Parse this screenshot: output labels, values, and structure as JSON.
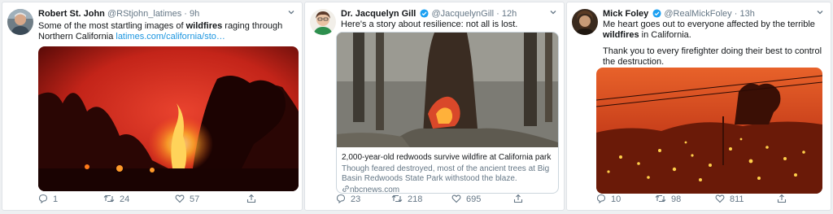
{
  "tweets": [
    {
      "name": "Robert St. John",
      "handle": "@RStjohn_latimes",
      "time": "9h",
      "text_before": "Some of the most startling images of ",
      "keyword": "wildfires",
      "text_after": " raging through Northern California ",
      "link": "latimes.com/california/sto…",
      "replies": "1",
      "retweets": "24",
      "likes": "57",
      "verified": false
    },
    {
      "name": "Dr. Jacquelyn Gill",
      "handle": "@JacquelynGill",
      "time": "12h",
      "text": "Here's a story about resilience: not all is lost.",
      "card": {
        "title": "2,000-year-old redwoods survive wildfire at California park",
        "description": "Though feared destroyed, most of the ancient trees at Big Basin Redwoods State Park withstood the blaze.",
        "domain": "nbcnews.com"
      },
      "replies": "23",
      "retweets": "218",
      "likes": "695",
      "verified": true
    },
    {
      "name": "Mick Foley",
      "handle": "@RealMickFoley",
      "time": "13h",
      "text_before": "Me heart goes out to everyone affected by the terrible ",
      "keyword": "wildfires",
      "text_after": " in California.",
      "text2": "Thank you to every firefighter doing their best to control the destruction.",
      "replies": "10",
      "retweets": "98",
      "likes": "811",
      "verified": true
    }
  ],
  "icons": [
    "chevron-down-icon",
    "verified-badge-icon",
    "reply-icon",
    "retweet-icon",
    "like-icon",
    "share-icon",
    "link-icon"
  ],
  "colors": {
    "accent": "#1da1f2",
    "link": "#1b95e0",
    "muted": "#657786",
    "fire": "#e8452c"
  }
}
